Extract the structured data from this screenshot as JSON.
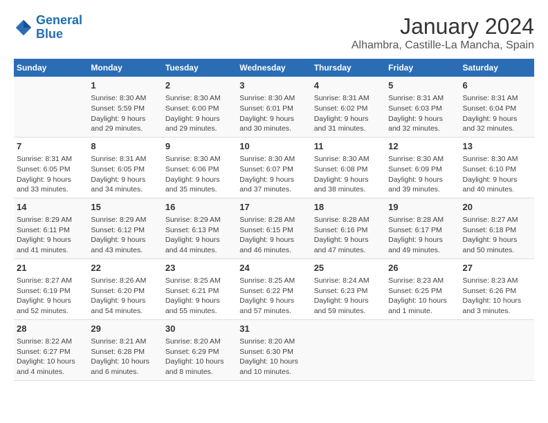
{
  "header": {
    "logo_line1": "General",
    "logo_line2": "Blue",
    "title": "January 2024",
    "subtitle": "Alhambra, Castille-La Mancha, Spain"
  },
  "weekdays": [
    "Sunday",
    "Monday",
    "Tuesday",
    "Wednesday",
    "Thursday",
    "Friday",
    "Saturday"
  ],
  "weeks": [
    [
      {
        "day": "",
        "content": ""
      },
      {
        "day": "1",
        "content": "Sunrise: 8:30 AM\nSunset: 5:59 PM\nDaylight: 9 hours\nand 29 minutes."
      },
      {
        "day": "2",
        "content": "Sunrise: 8:30 AM\nSunset: 6:00 PM\nDaylight: 9 hours\nand 29 minutes."
      },
      {
        "day": "3",
        "content": "Sunrise: 8:30 AM\nSunset: 6:01 PM\nDaylight: 9 hours\nand 30 minutes."
      },
      {
        "day": "4",
        "content": "Sunrise: 8:31 AM\nSunset: 6:02 PM\nDaylight: 9 hours\nand 31 minutes."
      },
      {
        "day": "5",
        "content": "Sunrise: 8:31 AM\nSunset: 6:03 PM\nDaylight: 9 hours\nand 32 minutes."
      },
      {
        "day": "6",
        "content": "Sunrise: 8:31 AM\nSunset: 6:04 PM\nDaylight: 9 hours\nand 32 minutes."
      }
    ],
    [
      {
        "day": "7",
        "content": "Sunrise: 8:31 AM\nSunset: 6:05 PM\nDaylight: 9 hours\nand 33 minutes."
      },
      {
        "day": "8",
        "content": "Sunrise: 8:31 AM\nSunset: 6:05 PM\nDaylight: 9 hours\nand 34 minutes."
      },
      {
        "day": "9",
        "content": "Sunrise: 8:30 AM\nSunset: 6:06 PM\nDaylight: 9 hours\nand 35 minutes."
      },
      {
        "day": "10",
        "content": "Sunrise: 8:30 AM\nSunset: 6:07 PM\nDaylight: 9 hours\nand 37 minutes."
      },
      {
        "day": "11",
        "content": "Sunrise: 8:30 AM\nSunset: 6:08 PM\nDaylight: 9 hours\nand 38 minutes."
      },
      {
        "day": "12",
        "content": "Sunrise: 8:30 AM\nSunset: 6:09 PM\nDaylight: 9 hours\nand 39 minutes."
      },
      {
        "day": "13",
        "content": "Sunrise: 8:30 AM\nSunset: 6:10 PM\nDaylight: 9 hours\nand 40 minutes."
      }
    ],
    [
      {
        "day": "14",
        "content": "Sunrise: 8:29 AM\nSunset: 6:11 PM\nDaylight: 9 hours\nand 41 minutes."
      },
      {
        "day": "15",
        "content": "Sunrise: 8:29 AM\nSunset: 6:12 PM\nDaylight: 9 hours\nand 43 minutes."
      },
      {
        "day": "16",
        "content": "Sunrise: 8:29 AM\nSunset: 6:13 PM\nDaylight: 9 hours\nand 44 minutes."
      },
      {
        "day": "17",
        "content": "Sunrise: 8:28 AM\nSunset: 6:15 PM\nDaylight: 9 hours\nand 46 minutes."
      },
      {
        "day": "18",
        "content": "Sunrise: 8:28 AM\nSunset: 6:16 PM\nDaylight: 9 hours\nand 47 minutes."
      },
      {
        "day": "19",
        "content": "Sunrise: 8:28 AM\nSunset: 6:17 PM\nDaylight: 9 hours\nand 49 minutes."
      },
      {
        "day": "20",
        "content": "Sunrise: 8:27 AM\nSunset: 6:18 PM\nDaylight: 9 hours\nand 50 minutes."
      }
    ],
    [
      {
        "day": "21",
        "content": "Sunrise: 8:27 AM\nSunset: 6:19 PM\nDaylight: 9 hours\nand 52 minutes."
      },
      {
        "day": "22",
        "content": "Sunrise: 8:26 AM\nSunset: 6:20 PM\nDaylight: 9 hours\nand 54 minutes."
      },
      {
        "day": "23",
        "content": "Sunrise: 8:25 AM\nSunset: 6:21 PM\nDaylight: 9 hours\nand 55 minutes."
      },
      {
        "day": "24",
        "content": "Sunrise: 8:25 AM\nSunset: 6:22 PM\nDaylight: 9 hours\nand 57 minutes."
      },
      {
        "day": "25",
        "content": "Sunrise: 8:24 AM\nSunset: 6:23 PM\nDaylight: 9 hours\nand 59 minutes."
      },
      {
        "day": "26",
        "content": "Sunrise: 8:23 AM\nSunset: 6:25 PM\nDaylight: 10 hours\nand 1 minute."
      },
      {
        "day": "27",
        "content": "Sunrise: 8:23 AM\nSunset: 6:26 PM\nDaylight: 10 hours\nand 3 minutes."
      }
    ],
    [
      {
        "day": "28",
        "content": "Sunrise: 8:22 AM\nSunset: 6:27 PM\nDaylight: 10 hours\nand 4 minutes."
      },
      {
        "day": "29",
        "content": "Sunrise: 8:21 AM\nSunset: 6:28 PM\nDaylight: 10 hours\nand 6 minutes."
      },
      {
        "day": "30",
        "content": "Sunrise: 8:20 AM\nSunset: 6:29 PM\nDaylight: 10 hours\nand 8 minutes."
      },
      {
        "day": "31",
        "content": "Sunrise: 8:20 AM\nSunset: 6:30 PM\nDaylight: 10 hours\nand 10 minutes."
      },
      {
        "day": "",
        "content": ""
      },
      {
        "day": "",
        "content": ""
      },
      {
        "day": "",
        "content": ""
      }
    ]
  ]
}
